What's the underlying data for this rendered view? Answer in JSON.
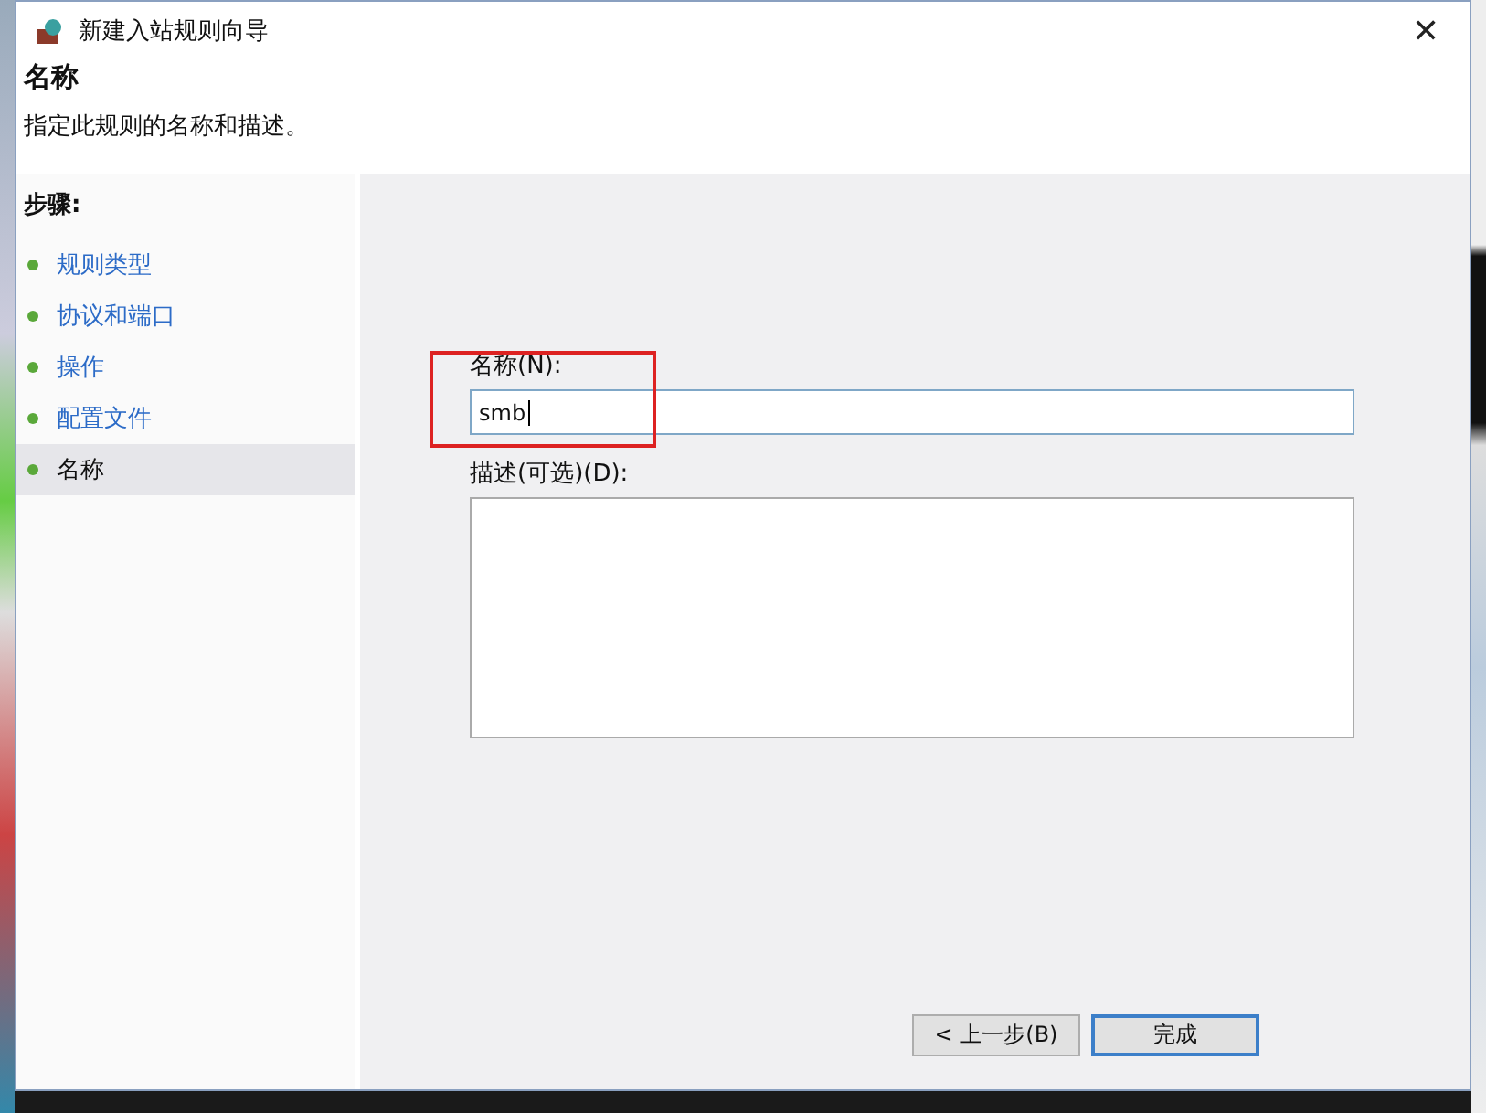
{
  "window": {
    "title": "新建入站规则向导",
    "close": "✕"
  },
  "header": {
    "title": "名称",
    "subtitle": "指定此规则的名称和描述。"
  },
  "steps": {
    "heading": "步骤:",
    "items": [
      {
        "label": "规则类型",
        "selected": false
      },
      {
        "label": "协议和端口",
        "selected": false
      },
      {
        "label": "操作",
        "selected": false
      },
      {
        "label": "配置文件",
        "selected": false
      },
      {
        "label": "名称",
        "selected": true
      }
    ]
  },
  "form": {
    "name_label": "名称(N):",
    "name_value": "smb",
    "description_label": "描述(可选)(D):"
  },
  "buttons": [
    {
      "label": "< 上一步(B)",
      "default": false
    },
    {
      "label": "完成",
      "default": true
    }
  ]
}
